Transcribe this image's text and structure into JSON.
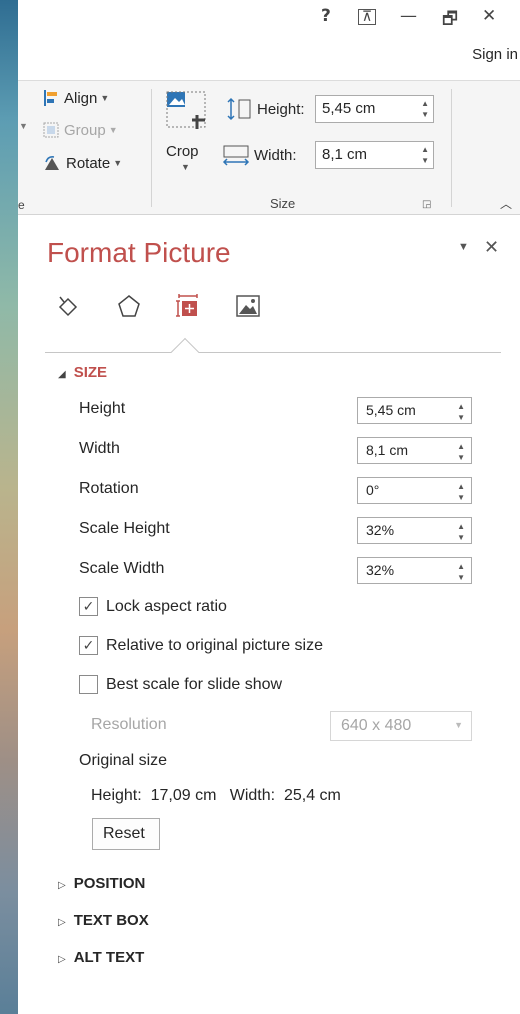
{
  "window": {
    "help": "?",
    "ribbon_display": "⊼",
    "minimize": "—",
    "restore": "🗗",
    "close": "✕",
    "sign_in": "Sign in"
  },
  "ribbon": {
    "align_label": "Align",
    "group_label": "Group",
    "rotate_label": "Rotate",
    "crop_label": "Crop",
    "height_label": "Height:",
    "height_value": "5,45 cm",
    "width_label": "Width:",
    "width_value": "8,1 cm",
    "size_group_label": "Size",
    "left_fragment": "e"
  },
  "pane": {
    "title": "Format Picture",
    "size_header": "SIZE",
    "height_label": "Height",
    "height_value": "5,45 cm",
    "width_label": "Width",
    "width_value": "8,1 cm",
    "rotation_label": "Rotation",
    "rotation_value": "0°",
    "scale_height_label": "Scale Height",
    "scale_height_value": "32%",
    "scale_width_label": "Scale Width",
    "scale_width_value": "32%",
    "lock_aspect_label": "Lock aspect ratio",
    "lock_aspect_checked": true,
    "relative_label": "Relative to original picture size",
    "relative_checked": true,
    "best_scale_label": "Best scale for slide show",
    "best_scale_checked": false,
    "resolution_label": "Resolution",
    "resolution_value": "640 x 480",
    "original_size_label": "Original size",
    "original_size_text": "Height:  17,09 cm   Width:  25,4 cm",
    "reset_label": "Reset",
    "position_header": "POSITION",
    "text_box_header": "TEXT BOX",
    "alt_text_header": "ALT TEXT"
  }
}
